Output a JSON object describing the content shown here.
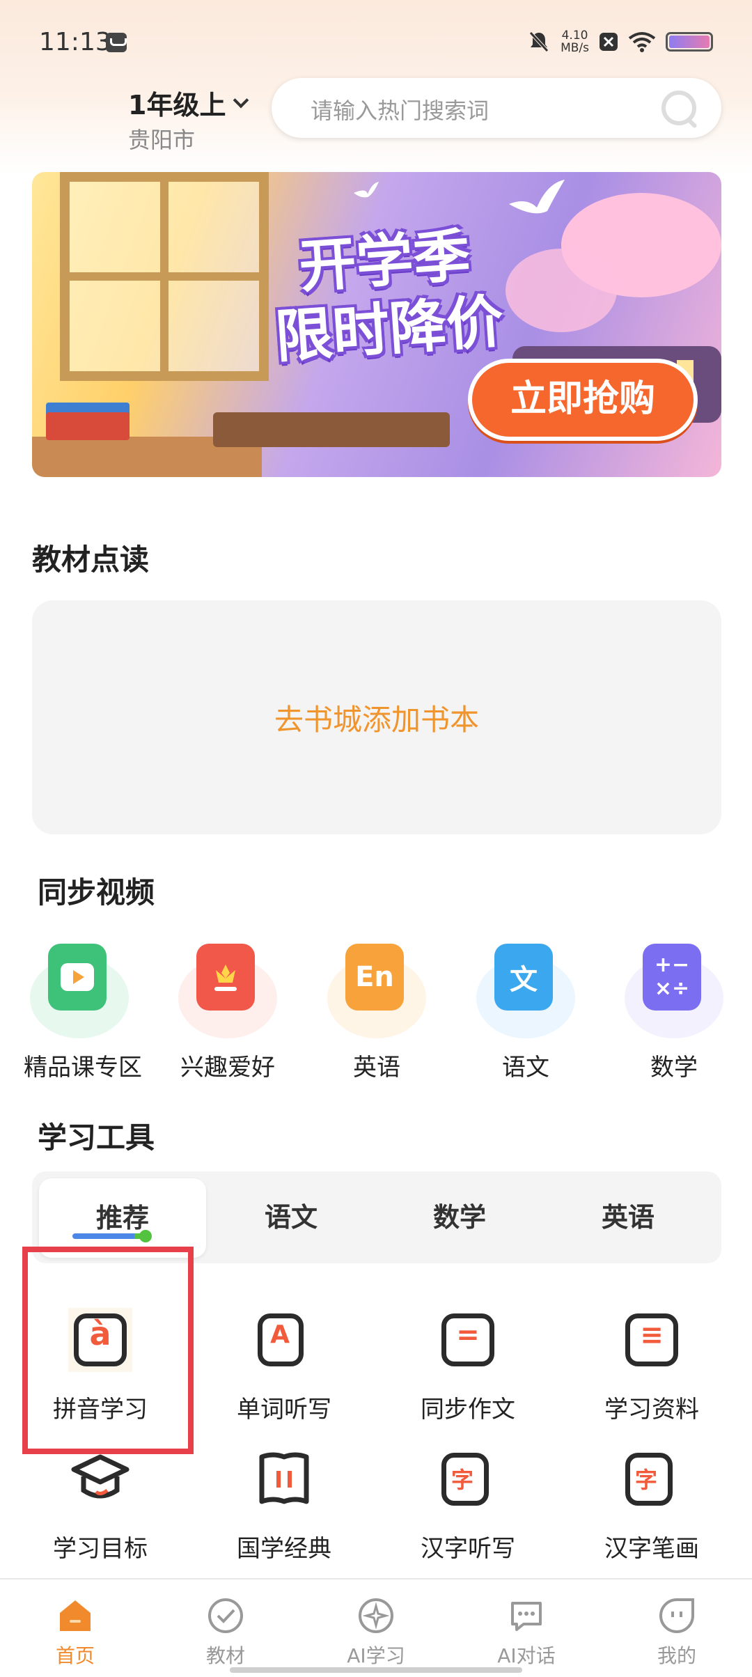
{
  "status_bar": {
    "time": "11:13",
    "net_speed_value": "4.10",
    "net_speed_unit": "MB/s",
    "icons": [
      "message-icon",
      "mute-icon",
      "close-box-icon",
      "wifi-icon",
      "battery-icon"
    ]
  },
  "header": {
    "grade": "1年级上",
    "city": "贵阳市",
    "search_placeholder": "请输入热门搜索词"
  },
  "banner": {
    "title": "开学季\n限时降价",
    "button": "立即抢购"
  },
  "textbook": {
    "title": "教材点读",
    "add_link": "去书城添加书本"
  },
  "videos": {
    "title": "同步视频",
    "items": [
      {
        "label": "精品课专区",
        "icon": "tv-play-icon",
        "color": "#3ec27a"
      },
      {
        "label": "兴趣爱好",
        "icon": "flower-book-icon",
        "color": "#f2584a"
      },
      {
        "label": "英语",
        "icon": "english-book-icon",
        "color": "#f7a23a",
        "glyph": "En"
      },
      {
        "label": "语文",
        "icon": "chinese-book-icon",
        "color": "#3aa7ee",
        "glyph": "文"
      },
      {
        "label": "数学",
        "icon": "math-book-icon",
        "color": "#7c6ef0",
        "glyph": "+−\n×÷"
      }
    ]
  },
  "tools": {
    "title": "学习工具",
    "tabs": [
      "推荐",
      "语文",
      "数学",
      "英语"
    ],
    "active_tab": "推荐",
    "items": [
      {
        "label": "拼音学习",
        "icon": "pinyin-icon",
        "glyph": "à"
      },
      {
        "label": "单词听写",
        "icon": "word-dictation-icon",
        "glyph": "A"
      },
      {
        "label": "同步作文",
        "icon": "composition-icon",
        "glyph": "="
      },
      {
        "label": "学习资料",
        "icon": "materials-icon",
        "glyph": "≡"
      },
      {
        "label": "学习目标",
        "icon": "graduation-cap-icon",
        "glyph": ""
      },
      {
        "label": "国学经典",
        "icon": "scroll-icon",
        "glyph": "‖"
      },
      {
        "label": "汉字听写",
        "icon": "hanzi-dictation-icon",
        "glyph": "字"
      },
      {
        "label": "汉字笔画",
        "icon": "hanzi-stroke-icon",
        "glyph": "字"
      }
    ]
  },
  "bottom_nav": {
    "items": [
      {
        "label": "首页",
        "icon": "home-icon"
      },
      {
        "label": "教材",
        "icon": "check-circle-icon"
      },
      {
        "label": "AI学习",
        "icon": "sparkle-icon"
      },
      {
        "label": "AI对话",
        "icon": "chat-bubble-icon"
      },
      {
        "label": "我的",
        "icon": "face-icon"
      }
    ],
    "active": "首页"
  },
  "colors": {
    "accent": "#f08a2c",
    "highlight_box": "#e8404a",
    "banner_button": "#f6672d"
  }
}
